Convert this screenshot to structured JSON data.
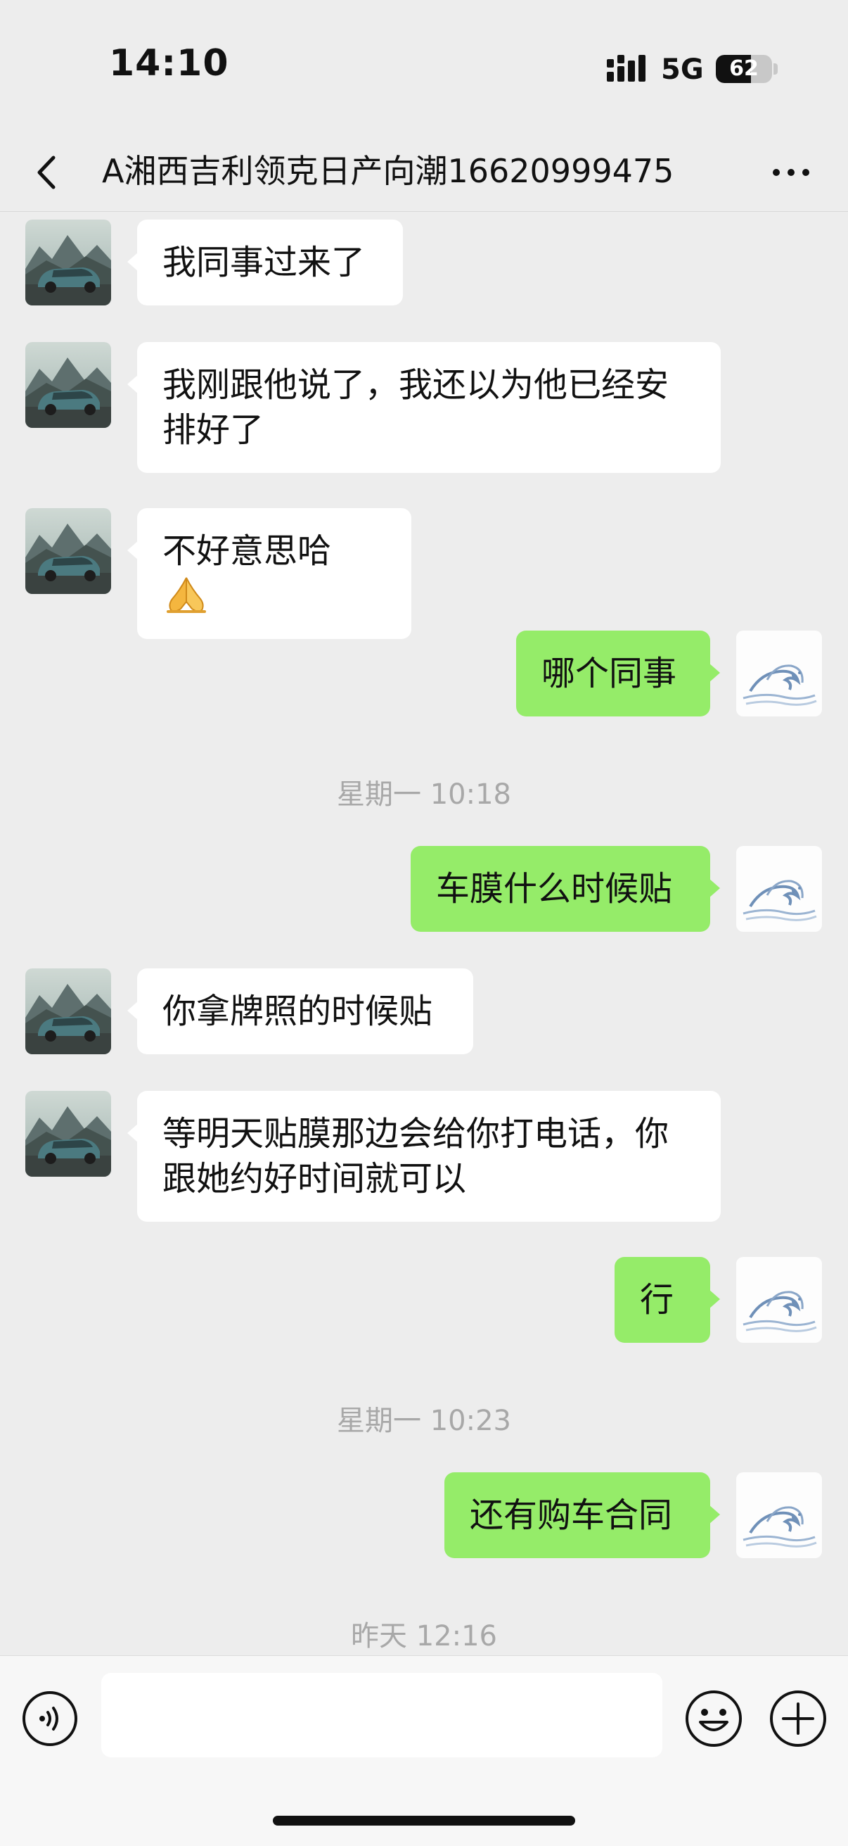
{
  "status_bar": {
    "time": "14:10",
    "network": "5G",
    "battery_percent": 62,
    "battery_label": "62"
  },
  "header": {
    "title": "A湘西吉利领克日产向潮16620999475",
    "back_icon": "chevron-left-icon",
    "more_icon": "ellipsis-icon"
  },
  "messages": [
    {
      "type": "in",
      "text": "我同事过来了"
    },
    {
      "type": "in",
      "text": "我刚跟他说了，我还以为他已经安排好了"
    },
    {
      "type": "in",
      "text": "不好意思哈",
      "emoji": "folded-hands-icon"
    },
    {
      "type": "out",
      "text": "哪个同事"
    },
    {
      "type": "time",
      "text": "星期一 10:18"
    },
    {
      "type": "out",
      "text": "车膜什么时候贴"
    },
    {
      "type": "in",
      "text": "你拿牌照的时候贴"
    },
    {
      "type": "in",
      "text": "等明天贴膜那边会给你打电话，你跟她约好时间就可以"
    },
    {
      "type": "out",
      "text": "行"
    },
    {
      "type": "time",
      "text": "星期一 10:23"
    },
    {
      "type": "out",
      "text": "还有购车合同"
    },
    {
      "type": "time",
      "text": "昨天 12:16"
    }
  ],
  "avatars": {
    "contact": "car-avatar-icon",
    "self": "wave-avatar-icon"
  },
  "input_bar": {
    "voice_icon": "voice-icon",
    "input_value": "",
    "emoji_icon": "smiley-icon",
    "plus_icon": "plus-circle-icon"
  },
  "colors": {
    "background": "#ededed",
    "outgoing_bubble": "#95ec69",
    "incoming_bubble": "#ffffff",
    "timestamp": "#a8a8a8"
  }
}
